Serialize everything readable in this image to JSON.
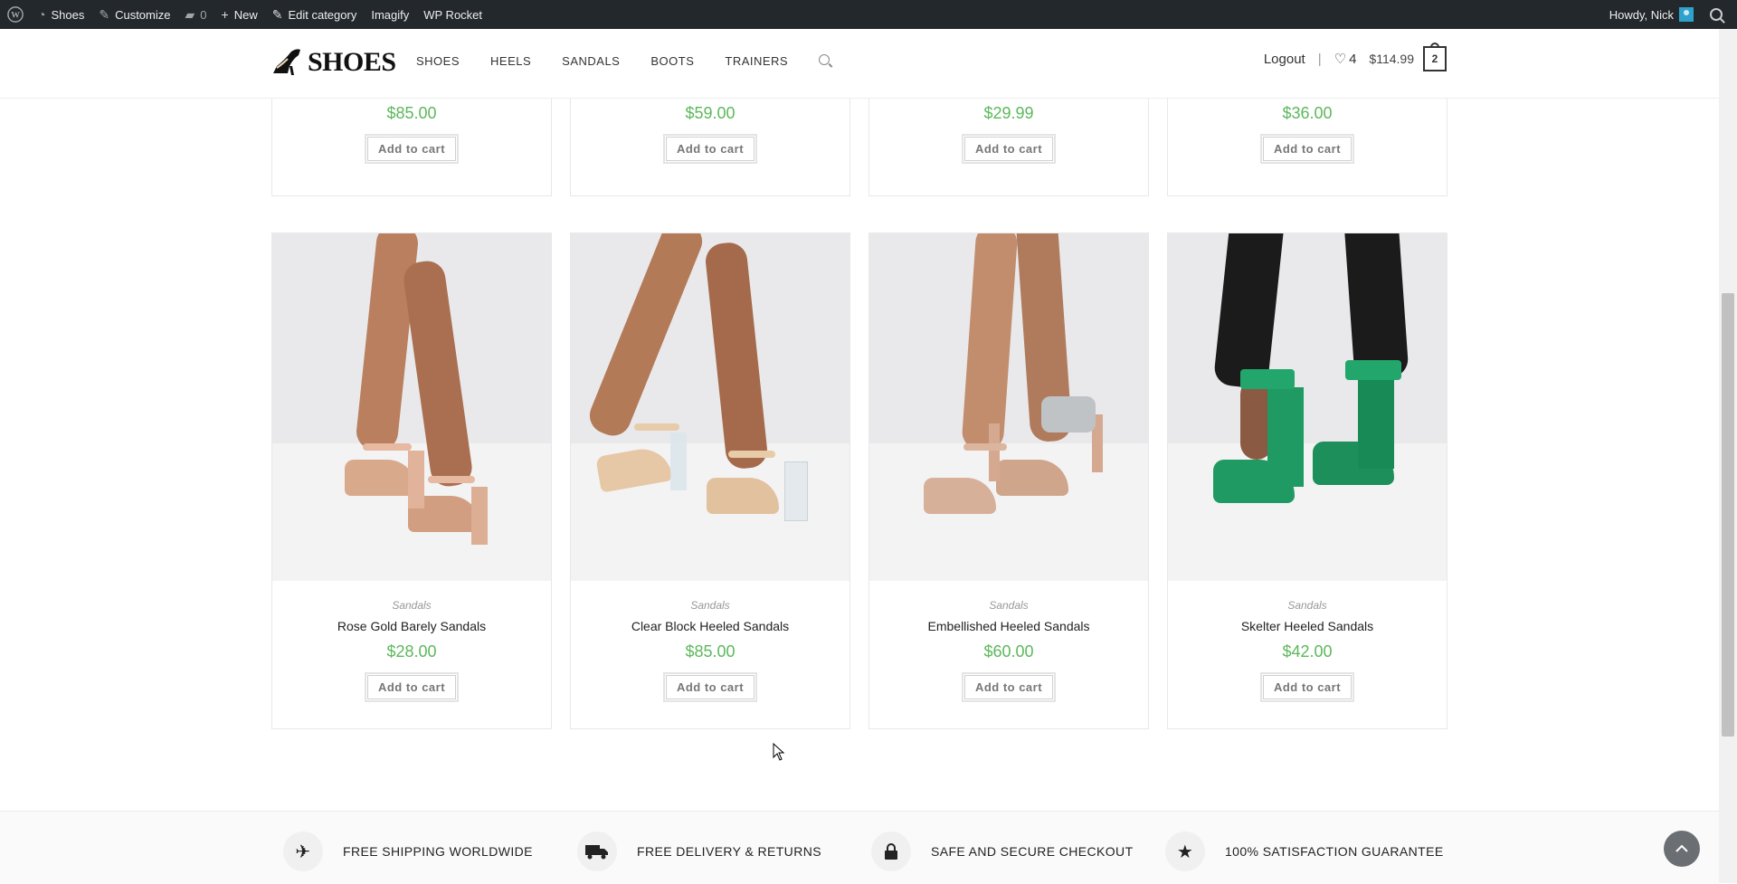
{
  "adminbar": {
    "site": "Shoes",
    "customize": "Customize",
    "comments_count": "0",
    "new": "New",
    "edit_category": "Edit category",
    "imagify": "Imagify",
    "wp_rocket": "WP Rocket",
    "greeting": "Howdy, Nick"
  },
  "header": {
    "logo_text": "SHOES",
    "nav": [
      "SHOES",
      "HEELS",
      "SANDALS",
      "BOOTS",
      "TRAINERS"
    ],
    "logout": "Logout",
    "separator": "|",
    "wishlist_count": "4",
    "cart_total": "$114.99",
    "cart_count": "2"
  },
  "top_row": [
    {
      "price": "$85.00",
      "button": "Add to cart"
    },
    {
      "price": "$59.00",
      "button": "Add to cart"
    },
    {
      "price": "$29.99",
      "button": "Add to cart"
    },
    {
      "price": "$36.00",
      "button": "Add to cart"
    }
  ],
  "products": [
    {
      "category": "Sandals",
      "name": "Rose Gold Barely Sandals",
      "price": "$28.00",
      "button": "Add to cart",
      "shoe_color": "#d9a98c",
      "leg_color": "#b97f5e"
    },
    {
      "category": "Sandals",
      "name": "Clear Block Heeled Sandals",
      "price": "$85.00",
      "button": "Add to cart",
      "shoe_color": "#e6c7a6",
      "leg_color": "#b37a58"
    },
    {
      "category": "Sandals",
      "name": "Embellished Heeled Sandals",
      "price": "$60.00",
      "button": "Add to cart",
      "shoe_color": "#d7b09a",
      "leg_color": "#c28d6d"
    },
    {
      "category": "Sandals",
      "name": "Skelter Heeled Sandals",
      "price": "$42.00",
      "button": "Add to cart",
      "shoe_color": "#1f9a63",
      "leg_color": "#1b1b1b"
    }
  ],
  "features": [
    {
      "icon": "plane-icon",
      "label": "FREE SHIPPING WORLDWIDE"
    },
    {
      "icon": "truck-icon",
      "label": "FREE DELIVERY & RETURNS"
    },
    {
      "icon": "lock-icon",
      "label": "SAFE AND SECURE CHECKOUT"
    },
    {
      "icon": "star-icon",
      "label": "100% SATISFACTION GUARANTEE"
    }
  ],
  "colors": {
    "price": "#5cb85c",
    "adminbar": "#23282d"
  }
}
